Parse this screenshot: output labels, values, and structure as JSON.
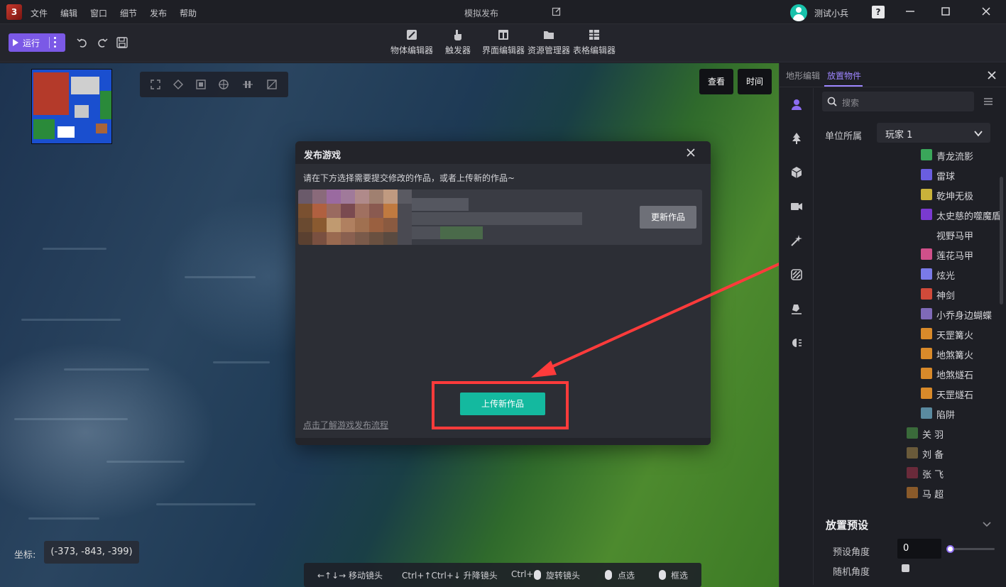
{
  "app": {
    "menu": [
      "文件",
      "编辑",
      "窗口",
      "细节",
      "发布",
      "帮助"
    ],
    "window_title": "模拟发布",
    "username": "测试小兵",
    "help_symbol": "?"
  },
  "toolbar": {
    "run_label": "运行",
    "editors": [
      "物体编辑器",
      "触发器",
      "界面编辑器",
      "资源管理器",
      "表格编辑器"
    ]
  },
  "viewport": {
    "view_button": "查看",
    "time_button": "时间",
    "coords_label": "坐标:",
    "coords_value": "(-373, -843, -399)",
    "shortcuts": [
      "←↑↓→ 移动镜头",
      "Ctrl+↑Ctrl+↓ 升降镜头",
      "Ctrl+",
      "旋转镜头",
      "点选",
      "框选"
    ]
  },
  "dialog": {
    "title": "发布游戏",
    "hint": "请在下方选择需要提交修改的作品，或者上传新的作品~",
    "update_button": "更新作品",
    "upload_button": "上传新作品",
    "learn_link": "点击了解游戏发布流程"
  },
  "panel": {
    "tabs": [
      "地形编辑",
      "放置物件"
    ],
    "active_tab": "放置物件",
    "search_placeholder": "搜索",
    "owner_label": "单位所属",
    "owner_value": "玩家 1",
    "units": [
      {
        "label": "青龙流影",
        "icon": "skill-icon",
        "color": "#3aa65a"
      },
      {
        "label": "雷球",
        "icon": "skill-icon",
        "color": "#6a5ee0"
      },
      {
        "label": "乾坤无极",
        "icon": "skill-icon",
        "color": "#c9b23a"
      },
      {
        "label": "太史慈的噬魔盾",
        "icon": "skill-icon",
        "color": "#7a3ad0"
      },
      {
        "label": "视野马甲",
        "icon": "",
        "color": ""
      },
      {
        "label": "莲花马甲",
        "icon": "skill-icon",
        "color": "#d0508a"
      },
      {
        "label": "炫光",
        "icon": "skill-icon",
        "color": "#7a7ae8"
      },
      {
        "label": "神剑",
        "icon": "skill-icon",
        "color": "#d04a3a"
      },
      {
        "label": "小乔身边蝴蝶",
        "icon": "skill-icon",
        "color": "#7f6ab8"
      },
      {
        "label": "天罡篝火",
        "icon": "skill-icon",
        "color": "#d98a2a"
      },
      {
        "label": "地煞篝火",
        "icon": "skill-icon",
        "color": "#d98a2a"
      },
      {
        "label": "地煞燧石",
        "icon": "skill-icon",
        "color": "#d98a2a"
      },
      {
        "label": "天罡燧石",
        "icon": "skill-icon",
        "color": "#d98a2a"
      },
      {
        "label": "陷阱",
        "icon": "skill-icon",
        "color": "#5a8aa0"
      },
      {
        "label": "关 羽",
        "icon": "hero-portrait",
        "color": "#3a6a3a"
      },
      {
        "label": "刘 备",
        "icon": "hero-portrait",
        "color": "#6a5a3a"
      },
      {
        "label": "张 飞",
        "icon": "hero-portrait",
        "color": "#6a2a3a"
      },
      {
        "label": "马 超",
        "icon": "hero-portrait",
        "color": "#8a5a2a"
      }
    ],
    "preset_title": "放置预设",
    "preset_angle_label": "预设角度",
    "preset_angle_value": "0",
    "random_angle_label": "随机角度"
  },
  "colors": {
    "accent": "#7b59e6",
    "primary_button": "#14b99f",
    "highlight": "#ff3b3b"
  }
}
